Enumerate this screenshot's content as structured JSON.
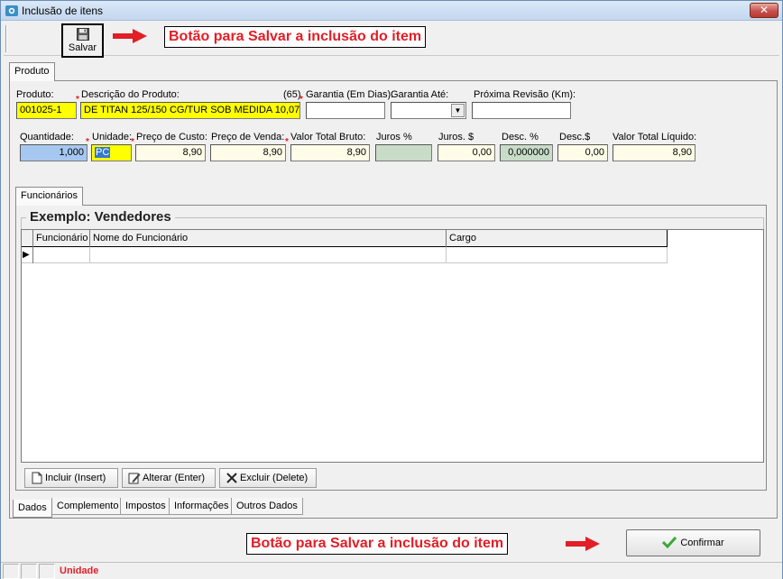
{
  "window": {
    "title": "Inclusão de itens",
    "close_label": "✕"
  },
  "toolbar": {
    "save_label": "Salvar"
  },
  "annotations": {
    "top_note": "Botão para Salvar a inclusão do item",
    "bottom_note": "Botão para Salvar a inclusão do item"
  },
  "tabs_top": [
    "Produto"
  ],
  "product": {
    "labels": {
      "produto": "Produto:",
      "descricao": "Descrição do Produto:",
      "desc_count": "(65)",
      "garantia_dias": "Garantia (Em Dias):",
      "garantia_ate": "Garantia Até:",
      "proxima_revisao": "Próxima Revisão (Km):"
    },
    "values": {
      "produto": "001025-1",
      "descricao": "DE TITAN 125/150 CG/TUR SOB MEDIDA 10,07",
      "garantia_dias": "",
      "garantia_ate": "",
      "proxima_revisao": ""
    }
  },
  "pricing": {
    "labels": {
      "quantidade": "Quantidade:",
      "unidade": "Unidade:",
      "preco_custo": "Preço de Custo:",
      "preco_venda": "Preço de Venda:",
      "valor_total_bruto": "Valor Total Bruto:",
      "juros_pct": "Juros %",
      "juros_val": "Juros. $",
      "desc_pct": "Desc. %",
      "desc_val": "Desc.$",
      "valor_total_liquido": "Valor Total Líquido:"
    },
    "values": {
      "quantidade": "1,000",
      "unidade": "PC",
      "preco_custo": "8,90",
      "preco_venda": "8,90",
      "valor_total_bruto": "8,90",
      "juros_pct": "",
      "juros_val": "0,00",
      "desc_pct": "0,000000",
      "desc_val": "0,00",
      "valor_total_liquido": "8,90"
    }
  },
  "inner_tabs": [
    "Funcionários"
  ],
  "group_title": "Exemplo: Vendedores",
  "grid": {
    "columns": [
      "Funcionário",
      "Nome do Funcionário",
      "Cargo"
    ],
    "row_indicator": "▶"
  },
  "grid_buttons": {
    "incluir": "Incluir (Insert)",
    "alterar": "Alterar (Enter)",
    "excluir": "Excluir (Delete)"
  },
  "bottom_tabs": [
    "Dados",
    "Complemento",
    "Impostos",
    "Informações",
    "Outros Dados"
  ],
  "confirm_label": "Confirmar",
  "status": {
    "text": "Unidade"
  },
  "colors": {
    "annotation_red": "#e21e26",
    "required_yellow": "#ffff00",
    "quantity_blue": "#a6c8f0"
  }
}
